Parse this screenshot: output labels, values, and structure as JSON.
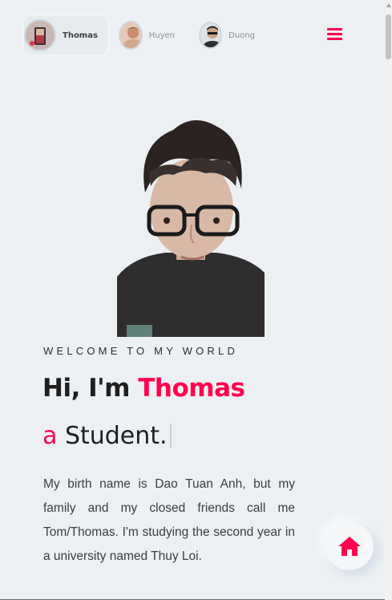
{
  "nav": {
    "profiles": [
      {
        "name": "Thomas",
        "active": true
      },
      {
        "name": "Huyen",
        "active": false
      },
      {
        "name": "Duong",
        "active": false
      }
    ],
    "menu_icon": "hamburger-menu-icon"
  },
  "hero": {
    "welcome": "WELCOME TO MY WORLD",
    "greeting_prefix": "Hi, I'm ",
    "name": "Thomas",
    "role_article": "a",
    "role": "Student.",
    "bio": "My birth name is Dao Tuan Anh, but my family and my closed friends call me Tom/Thomas. I'm studying the second year in a university named Thuy Loi."
  },
  "home_button": {
    "icon": "home-icon"
  },
  "colors": {
    "accent": "#ff014f",
    "background": "#ecf0f3",
    "text": "#3c3e41"
  }
}
